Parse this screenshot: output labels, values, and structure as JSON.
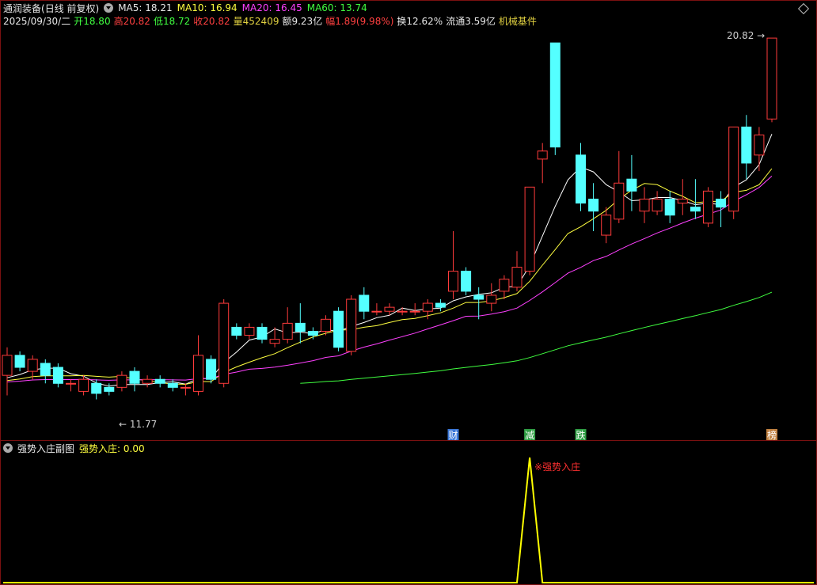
{
  "header": {
    "stock_name": "通润装备",
    "period": "(日线 前复权)",
    "ma5": "MA5: 18.21",
    "ma10": "MA10: 16.94",
    "ma20": "MA20: 16.45",
    "ma60": "MA60: 13.74",
    "date": "2025/09/30/二",
    "open": "开18.80",
    "high": "高20.82",
    "low": "低18.72",
    "close": "收20.82",
    "volume": "量452409",
    "amount": "额9.23亿",
    "change": "幅1.89(9.98%)",
    "turnover": "换12.62%",
    "float": "流通3.59亿",
    "industry": "机械基件"
  },
  "sub": {
    "title": "强势入庄副图",
    "indicator": "强势入庄: 0.00",
    "signal_label": "※强势入庄"
  },
  "markers": [
    {
      "label": "财",
      "index": 35,
      "color": "#3c78d8"
    },
    {
      "label": "减",
      "index": 41,
      "color": "#2f9e44"
    },
    {
      "label": "跌",
      "index": 45,
      "color": "#2f9e44"
    },
    {
      "label": "榜",
      "index": 60,
      "color": "#c08040"
    }
  ],
  "chart_data": {
    "type": "candlestick",
    "high_label": "20.82",
    "low_label": "11.77",
    "candles": [
      [
        12.4,
        12.9,
        11.9,
        13.1
      ],
      [
        12.9,
        12.6,
        12.5,
        13.0
      ],
      [
        12.5,
        12.8,
        12.3,
        12.9
      ],
      [
        12.7,
        12.4,
        12.2,
        12.8
      ],
      [
        12.6,
        12.2,
        12.1,
        12.7
      ],
      [
        12.2,
        12.2,
        12.0,
        12.3
      ],
      [
        12.0,
        12.3,
        11.9,
        12.4
      ],
      [
        12.2,
        11.95,
        11.8,
        12.3
      ],
      [
        12.1,
        12.0,
        11.9,
        12.2
      ],
      [
        12.1,
        12.4,
        12.0,
        12.5
      ],
      [
        12.5,
        12.2,
        12.0,
        12.6
      ],
      [
        12.2,
        12.3,
        12.1,
        12.4
      ],
      [
        12.3,
        12.2,
        12.1,
        12.4
      ],
      [
        12.2,
        12.1,
        12.0,
        12.3
      ],
      [
        12.1,
        12.1,
        11.9,
        12.2
      ],
      [
        12.0,
        12.9,
        11.9,
        13.4
      ],
      [
        12.8,
        12.3,
        12.2,
        12.9
      ],
      [
        12.2,
        14.2,
        12.1,
        14.3
      ],
      [
        13.6,
        13.4,
        13.3,
        13.7
      ],
      [
        13.4,
        13.6,
        13.3,
        13.7
      ],
      [
        13.6,
        13.3,
        13.2,
        13.7
      ],
      [
        13.2,
        13.3,
        13.1,
        13.6
      ],
      [
        13.3,
        13.7,
        13.2,
        14.1
      ],
      [
        13.7,
        13.5,
        13.2,
        14.2
      ],
      [
        13.5,
        13.4,
        13.3,
        13.6
      ],
      [
        13.5,
        13.8,
        13.4,
        13.9
      ],
      [
        14.0,
        13.1,
        13.0,
        14.1
      ],
      [
        13.0,
        14.3,
        12.9,
        14.4
      ],
      [
        14.4,
        14.0,
        13.8,
        14.6
      ],
      [
        14.0,
        14.0,
        13.9,
        14.2
      ],
      [
        14.0,
        14.1,
        13.9,
        14.2
      ],
      [
        14.0,
        14.0,
        13.9,
        14.1
      ],
      [
        14.0,
        14.0,
        13.9,
        14.2
      ],
      [
        14.0,
        14.2,
        13.8,
        14.3
      ],
      [
        14.2,
        14.1,
        14.0,
        14.3
      ],
      [
        14.5,
        15.0,
        14.3,
        16.0
      ],
      [
        15.0,
        14.5,
        14.4,
        15.1
      ],
      [
        14.4,
        14.3,
        13.8,
        14.6
      ],
      [
        14.2,
        14.4,
        14.0,
        14.7
      ],
      [
        14.5,
        14.8,
        14.3,
        14.9
      ],
      [
        14.6,
        15.1,
        14.5,
        15.5
      ],
      [
        15.0,
        17.1,
        14.9,
        17.1
      ],
      [
        17.8,
        18.0,
        17.2,
        18.2
      ],
      [
        20.7,
        18.1,
        17.9,
        20.7
      ],
      null,
      [
        17.9,
        16.7,
        16.5,
        18.2
      ],
      [
        16.8,
        16.5,
        16.0,
        17.2
      ],
      [
        15.9,
        16.4,
        15.7,
        16.6
      ],
      [
        16.3,
        17.2,
        16.2,
        18.0
      ],
      [
        17.3,
        17.0,
        16.5,
        17.9
      ],
      [
        16.5,
        16.8,
        16.2,
        17.1
      ],
      [
        16.5,
        16.8,
        16.4,
        17.0
      ],
      [
        16.8,
        16.4,
        16.2,
        17.0
      ],
      [
        16.7,
        16.8,
        16.4,
        17.3
      ],
      [
        16.6,
        16.5,
        16.3,
        17.3
      ],
      [
        16.2,
        17.0,
        16.1,
        17.1
      ],
      [
        16.8,
        16.6,
        16.1,
        17.0
      ],
      [
        16.5,
        18.6,
        16.3,
        18.6
      ],
      [
        18.6,
        17.7,
        17.3,
        18.9
      ],
      [
        17.9,
        18.4,
        17.5,
        18.6
      ],
      [
        18.8,
        20.82,
        18.72,
        20.82
      ]
    ],
    "ma": [
      {
        "name": "MA5",
        "color": "#ffffff"
      },
      {
        "name": "MA10",
        "color": "#ffff40"
      },
      {
        "name": "MA20",
        "color": "#ff40ff"
      },
      {
        "name": "MA60",
        "color": "#40ff40"
      }
    ],
    "indicator_series": {
      "name": "强势入庄",
      "color": "#ffff00",
      "values": [
        0,
        0,
        0,
        0,
        0,
        0,
        0,
        0,
        0,
        0,
        0,
        0,
        0,
        0,
        0,
        0,
        0,
        0,
        0,
        0,
        0,
        0,
        0,
        0,
        0,
        0,
        0,
        0,
        0,
        0,
        0,
        0,
        0,
        0,
        0,
        0,
        0,
        0,
        0,
        0,
        0,
        1,
        0,
        0,
        0,
        0,
        0,
        0,
        0,
        0,
        0,
        0,
        0,
        0,
        0,
        0,
        0,
        0,
        0,
        0,
        0
      ]
    }
  }
}
